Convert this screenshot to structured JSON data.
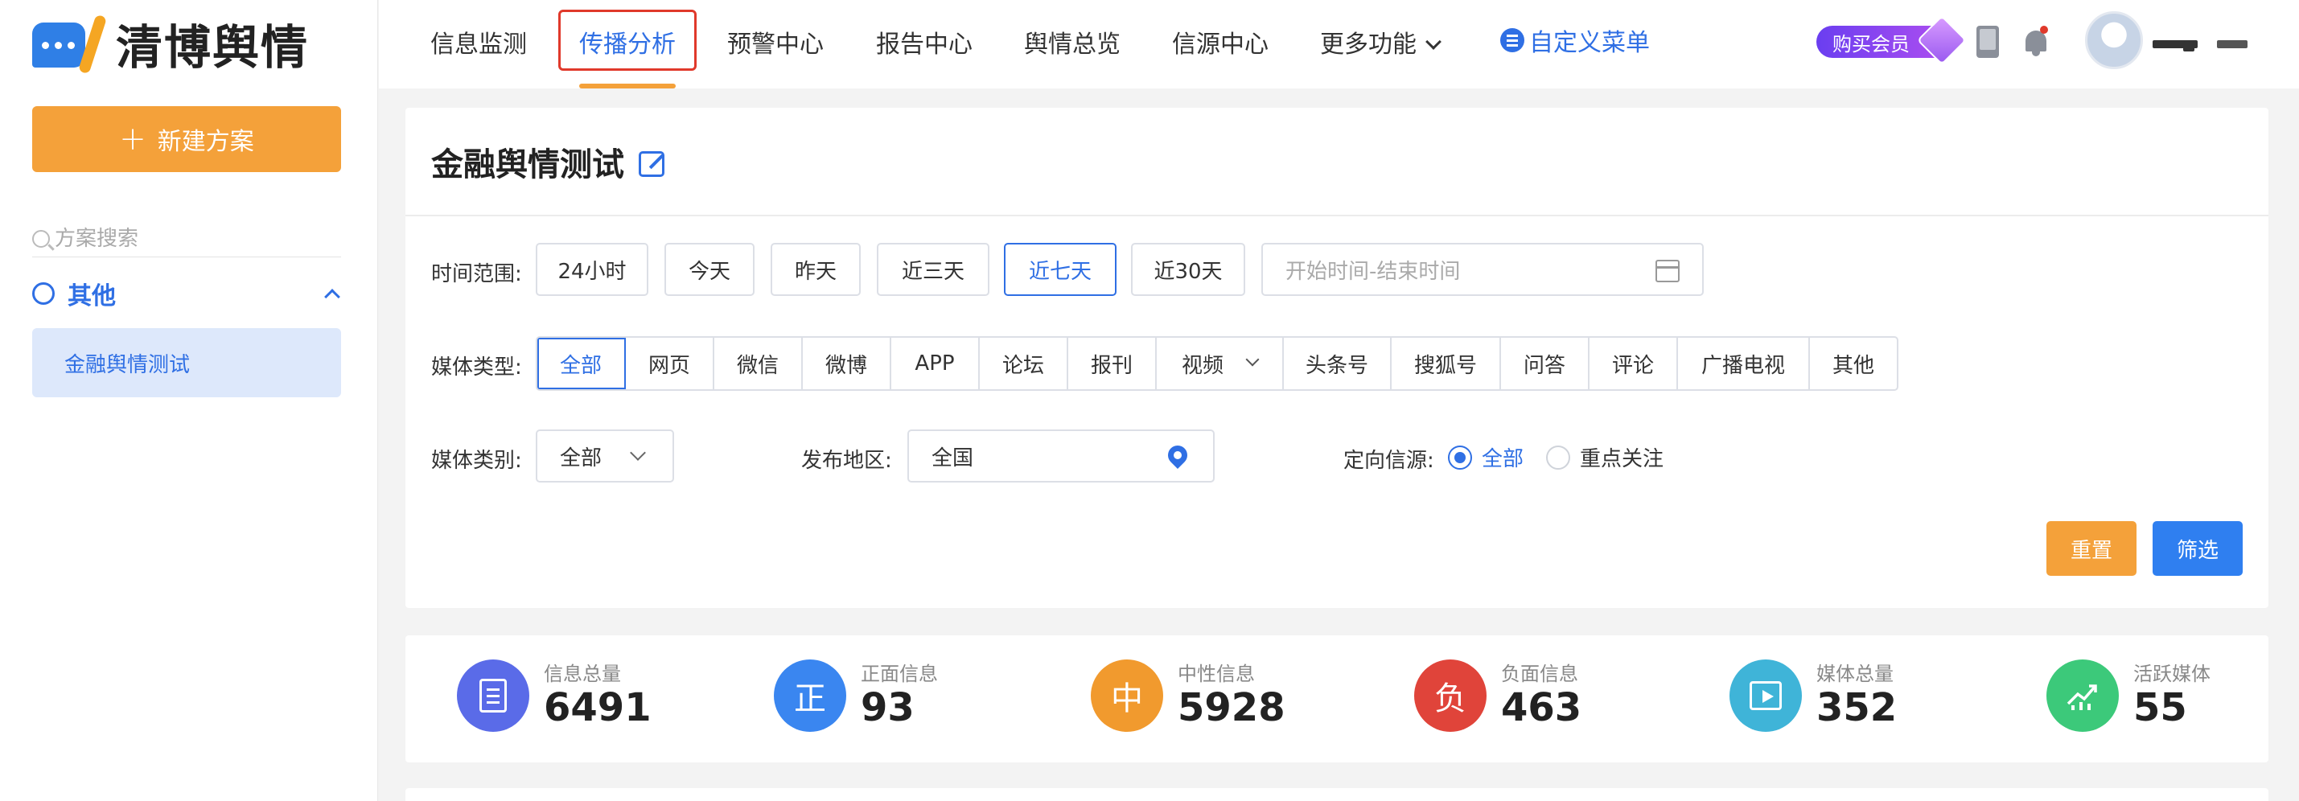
{
  "brand": {
    "name": "清博舆情"
  },
  "sidebar": {
    "new_plan_label": "新建方案",
    "search_placeholder": "方案搜索",
    "group_label": "其他",
    "items": [
      {
        "label": "金融舆情测试"
      }
    ]
  },
  "nav": {
    "tabs": [
      {
        "label": "信息监测"
      },
      {
        "label": "传播分析"
      },
      {
        "label": "预警中心"
      },
      {
        "label": "报告中心"
      },
      {
        "label": "舆情总览"
      },
      {
        "label": "信源中心"
      },
      {
        "label": "更多功能"
      }
    ],
    "custom_menu_label": "自定义菜单",
    "vip_label": "购买会员",
    "active_tab": "传播分析"
  },
  "filter": {
    "title": "金融舆情测试",
    "time_label": "时间范围:",
    "time_options": [
      "24小时",
      "今天",
      "昨天",
      "近三天",
      "近七天",
      "近30天"
    ],
    "time_selected": "近七天",
    "date_placeholder": "开始时间-结束时间",
    "media_type_label": "媒体类型:",
    "media_types": [
      "全部",
      "网页",
      "微信",
      "微博",
      "APP",
      "论坛",
      "报刊",
      "视频",
      "头条号",
      "搜狐号",
      "问答",
      "评论",
      "广播电视",
      "其他"
    ],
    "media_type_selected": "全部",
    "media_category_label": "媒体类别:",
    "media_category_value": "全部",
    "region_label": "发布地区:",
    "region_value": "全国",
    "source_label": "定向信源:",
    "source_options": [
      "全部",
      "重点关注"
    ],
    "source_selected": "全部",
    "reset_label": "重置",
    "filter_label": "筛选"
  },
  "stats": [
    {
      "name": "信息总量",
      "value": "6491",
      "color": "#5a6be8",
      "icon": "document-icon"
    },
    {
      "name": "正面信息",
      "value": "93",
      "color": "#3a86f0",
      "icon": "positive-icon",
      "glyph": "正"
    },
    {
      "name": "中性信息",
      "value": "5928",
      "color": "#f19a2e",
      "icon": "neutral-icon",
      "glyph": "中"
    },
    {
      "name": "负面信息",
      "value": "463",
      "color": "#e0443a",
      "icon": "negative-icon",
      "glyph": "负"
    },
    {
      "name": "媒体总量",
      "value": "352",
      "color": "#3fb4d8",
      "icon": "media-icon"
    },
    {
      "name": "活跃媒体",
      "value": "55",
      "color": "#3cc97a",
      "icon": "trend-icon"
    }
  ],
  "colors": {
    "accent": "#2f6fe4",
    "orange": "#f4a13a",
    "highlight_box": "#e0392b"
  }
}
